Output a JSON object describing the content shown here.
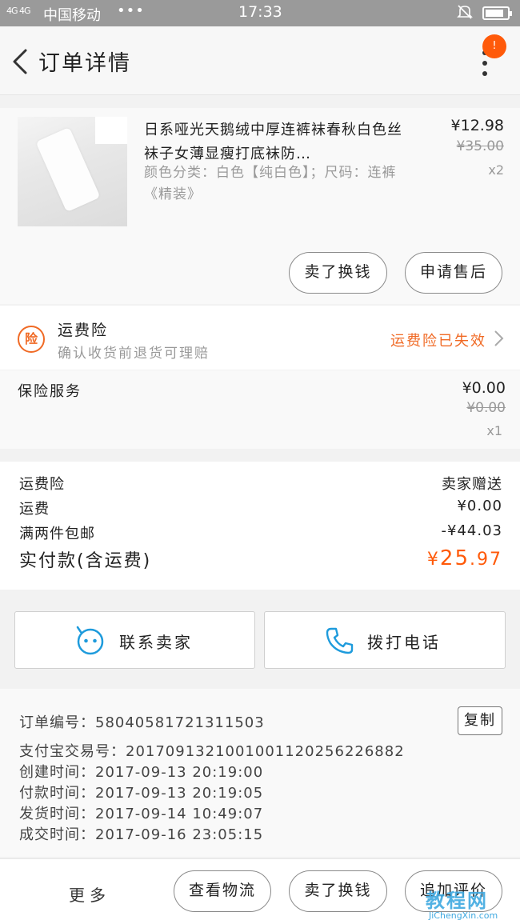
{
  "status_bar": {
    "signal": "4G 4G",
    "carrier": "中国移动",
    "dots": "•••",
    "time": "17:33"
  },
  "nav": {
    "title": "订单详情",
    "badge": "!"
  },
  "product": {
    "name": "日系哑光天鹅绒中厚连裤袜春秋白色丝袜子女薄显瘦打底袜防…",
    "spec": "颜色分类：白色【纯白色】；尺码：连裤《精装》",
    "price": "¥12.98",
    "original_price": "¥35.00",
    "quantity": "x2",
    "btn_sell": "卖了换钱",
    "btn_aftersale": "申请售后"
  },
  "freight_insurance": {
    "icon_text": "险",
    "title": "运费险",
    "subtitle": "确认收货前退货可理赔",
    "status": "运费险已失效"
  },
  "insurance_service": {
    "title": "保险服务",
    "price": "¥0.00",
    "original_price": "¥0.00",
    "quantity": "x1"
  },
  "summary": {
    "rows": [
      {
        "label": "运费险",
        "value": "卖家赠送"
      },
      {
        "label": "运费",
        "value": "¥0.00"
      },
      {
        "label": "满两件包邮",
        "value": "-¥44.03"
      }
    ],
    "total_label": "实付款(含运费)",
    "total_currency": "¥",
    "total_int": "25",
    "total_dec": ".97"
  },
  "contact": {
    "seller": "联系卖家",
    "call": "拨打电话"
  },
  "order_info": {
    "order_no": "订单编号：58040581721311503",
    "copy": "复制",
    "alipay_no": "支付宝交易号：2017091321001001120256226882",
    "created": "创建时间：2017-09-13 20:19:00",
    "paid": "付款时间：2017-09-13 20:19:05",
    "shipped": "发货时间：2017-09-14 10:49:07",
    "completed": "成交时间：2017-09-16 23:05:15"
  },
  "bottom_bar": {
    "more": "更多",
    "logistics": "查看物流",
    "sell": "卖了换钱",
    "review": "追加评价"
  },
  "watermark": {
    "logo": "教程网",
    "url": "JiChengXin.com"
  },
  "colors": {
    "accent": "#ff5a0a",
    "freight_orange": "#f06a25",
    "contact_blue": "#1e9bdc"
  }
}
